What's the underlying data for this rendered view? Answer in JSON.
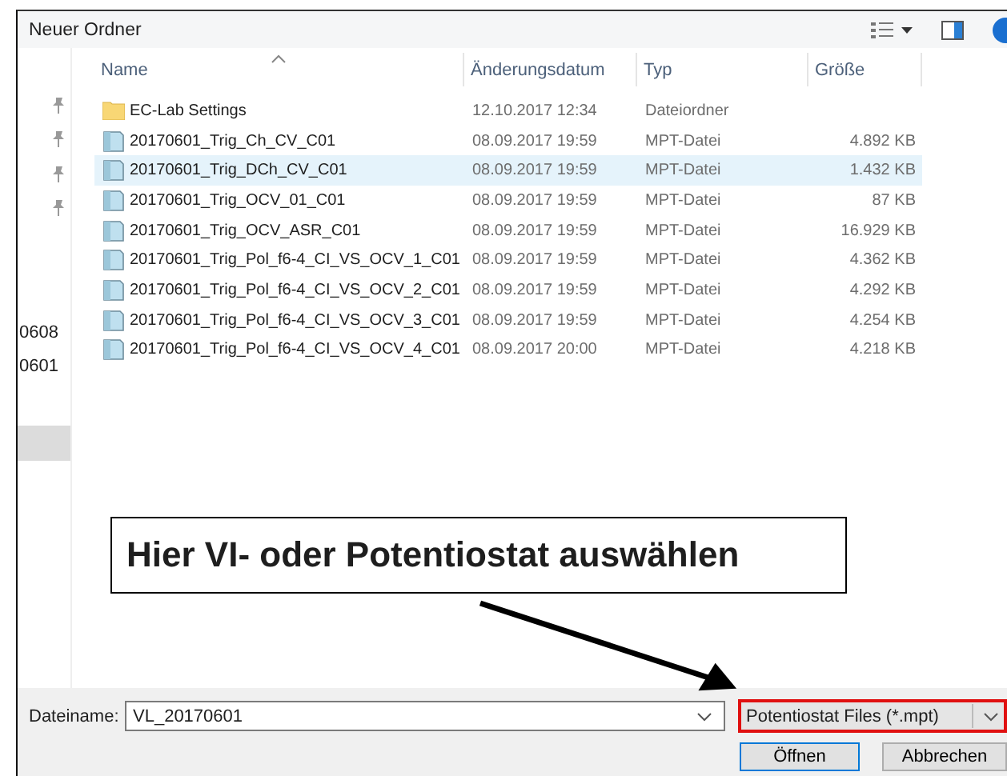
{
  "window": {
    "title": "Neuer Ordner"
  },
  "nav": {
    "items": [
      {
        "pinned": true
      },
      {
        "pinned": true
      },
      {
        "pinned": true
      },
      {
        "pinned": true
      },
      {
        "pinned": false,
        "label": "0608"
      },
      {
        "pinned": false,
        "label": "0601"
      }
    ]
  },
  "table": {
    "columns": [
      {
        "label": "Name",
        "sorted": true
      },
      {
        "label": "Änderungsdatum",
        "sorted": false
      },
      {
        "label": "Typ",
        "sorted": false
      },
      {
        "label": "Größe",
        "sorted": false
      }
    ],
    "rows": [
      {
        "kind": "folder",
        "name": "EC-Lab Settings",
        "date": "12.10.2017 12:34",
        "type": "Dateiordner",
        "selected": false
      },
      {
        "kind": "file",
        "name": "20170601_Trig_Ch_CV_C01",
        "date": "08.09.2017 19:59",
        "type": "MPT-Datei",
        "size": "4.892 KB",
        "selected": false
      },
      {
        "kind": "file",
        "name": "20170601_Trig_DCh_CV_C01",
        "date": "08.09.2017 19:59",
        "type": "MPT-Datei",
        "size": "1.432 KB",
        "selected": true
      },
      {
        "kind": "file",
        "name": "20170601_Trig_OCV_01_C01",
        "date": "08.09.2017 19:59",
        "type": "MPT-Datei",
        "size": "87 KB",
        "selected": false
      },
      {
        "kind": "file",
        "name": "20170601_Trig_OCV_ASR_C01",
        "date": "08.09.2017 19:59",
        "type": "MPT-Datei",
        "size": "16.929 KB",
        "selected": false
      },
      {
        "kind": "file",
        "name": "20170601_Trig_Pol_f6-4_CI_VS_OCV_1_C01",
        "date": "08.09.2017 19:59",
        "type": "MPT-Datei",
        "size": "4.362 KB",
        "selected": false
      },
      {
        "kind": "file",
        "name": "20170601_Trig_Pol_f6-4_CI_VS_OCV_2_C01",
        "date": "08.09.2017 19:59",
        "type": "MPT-Datei",
        "size": "4.292 KB",
        "selected": false
      },
      {
        "kind": "file",
        "name": "20170601_Trig_Pol_f6-4_CI_VS_OCV_3_C01",
        "date": "08.09.2017 19:59",
        "type": "MPT-Datei",
        "size": "4.254 KB",
        "selected": false
      },
      {
        "kind": "file",
        "name": "20170601_Trig_Pol_f6-4_CI_VS_OCV_4_C01",
        "date": "08.09.2017 20:00",
        "type": "MPT-Datei",
        "size": "4.218 KB",
        "selected": false
      }
    ]
  },
  "footer": {
    "filename_label": "Dateiname:",
    "filename_value": "VL_20170601",
    "filter": "Potentiostat Files (*.mpt)",
    "filter_highlighted": true,
    "buttons": [
      {
        "label": "Öffnen",
        "default": true
      },
      {
        "label": "Abbrechen",
        "default": false
      }
    ]
  },
  "annotation": {
    "text": "Hier VI- oder Potentiostat auswählen"
  }
}
